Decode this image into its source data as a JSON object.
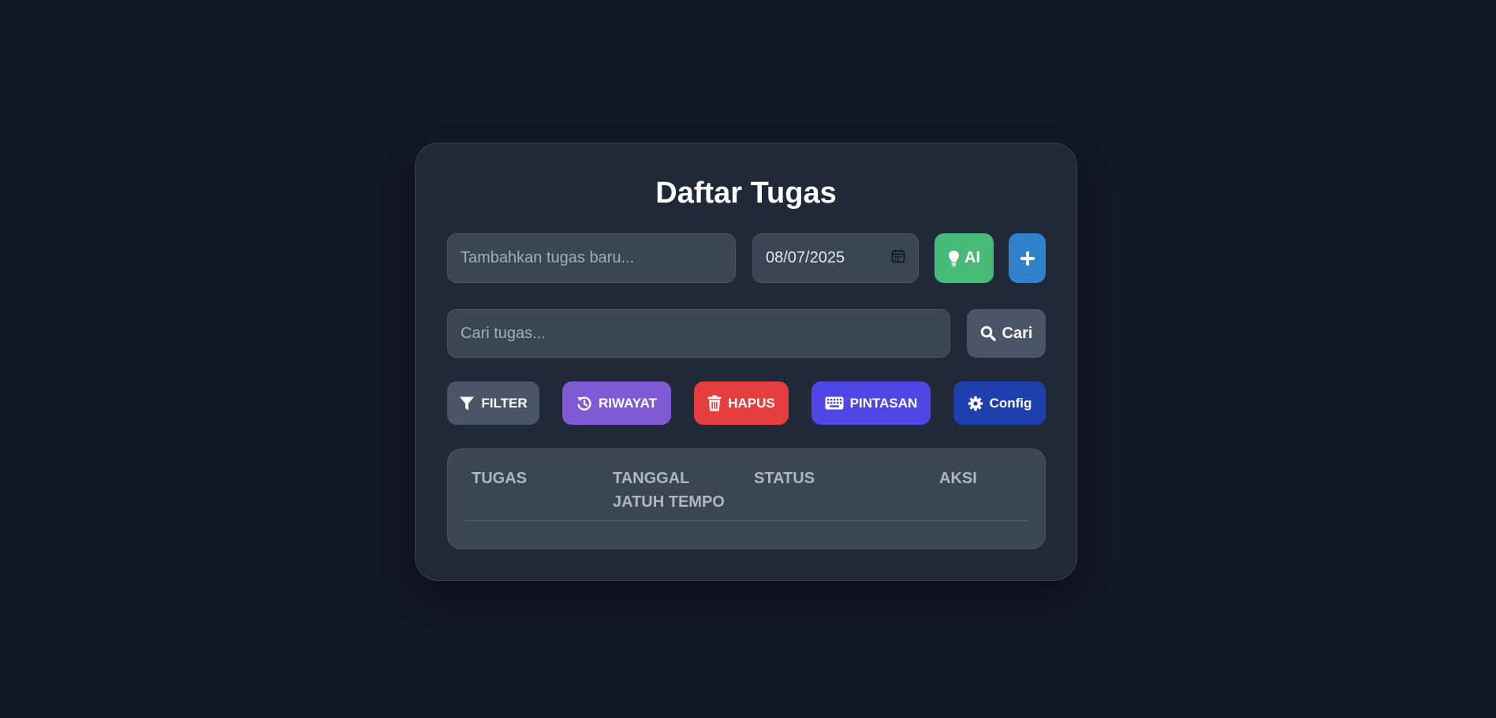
{
  "app": {
    "title": "Daftar Tugas"
  },
  "add_task": {
    "placeholder": "Tambahkan tugas baru...",
    "date_value": "08/07/2025",
    "ai_label": "AI",
    "add_icon": "plus-icon"
  },
  "search": {
    "placeholder": "Cari tugas...",
    "button_label": "Cari",
    "icon": "search-icon"
  },
  "toolbar": {
    "filter_label": "FILTER",
    "history_label": "RIWAYAT",
    "delete_label": "HAPUS",
    "shortcuts_label": "PINTASAN",
    "config_label": "Config"
  },
  "table": {
    "columns": [
      "TUGAS",
      "TANGGAL JATUH TEMPO",
      "STATUS",
      "AKSI"
    ],
    "col_due_line1": "TANGGAL",
    "col_due_line2": "JATUH TEMPO",
    "rows": []
  },
  "colors": {
    "background": "#111827",
    "card": "#1f2937",
    "ai_button": "#48bb78",
    "add_button": "#3182ce",
    "search_button": "#4a5568",
    "filter_button": "#4a5568",
    "history_button": "#805ad5",
    "delete_button": "#e53e3e",
    "shortcuts_button": "#4f46e5",
    "config_button": "#1e40af"
  }
}
